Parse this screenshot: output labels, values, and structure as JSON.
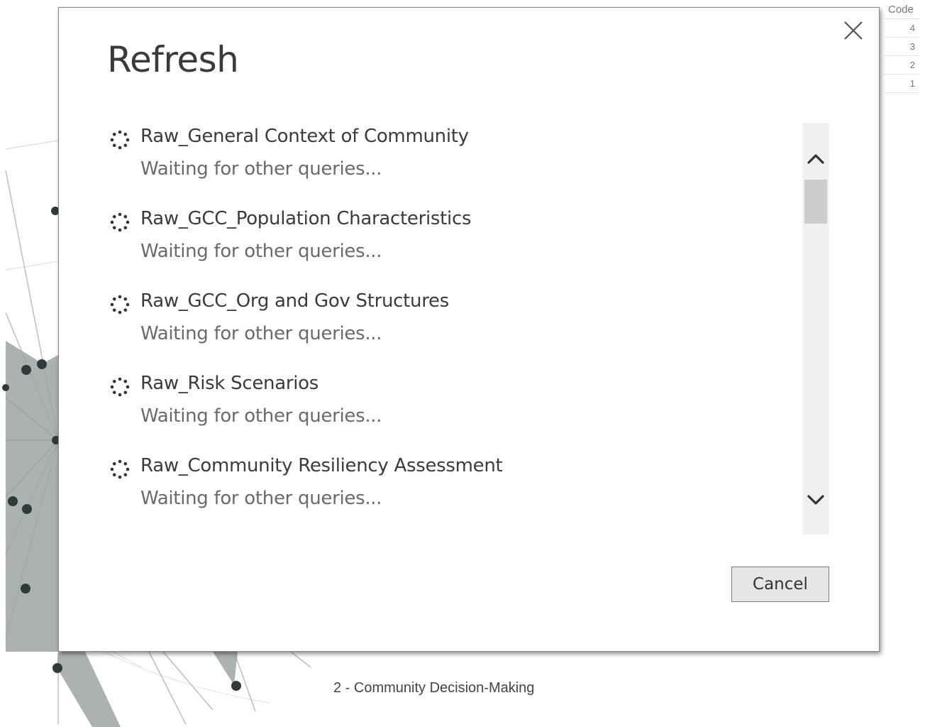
{
  "dialog": {
    "title": "Refresh",
    "close_icon": "close-icon",
    "queries": [
      {
        "name": "Raw_General Context of Community",
        "status": "Waiting for other queries..."
      },
      {
        "name": "Raw_GCC_Population Characteristics",
        "status": "Waiting for other queries..."
      },
      {
        "name": "Raw_GCC_Org and Gov Structures",
        "status": "Waiting for other queries..."
      },
      {
        "name": "Raw_Risk Scenarios",
        "status": "Waiting for other queries..."
      },
      {
        "name": "Raw_Community Resiliency Assessment",
        "status": "Waiting for other queries..."
      }
    ],
    "cancel_label": "Cancel"
  },
  "background": {
    "chart_label": "2 - Community Decision-Making",
    "table_header": "Code",
    "table_values": [
      "4",
      "3",
      "2",
      "1"
    ]
  }
}
